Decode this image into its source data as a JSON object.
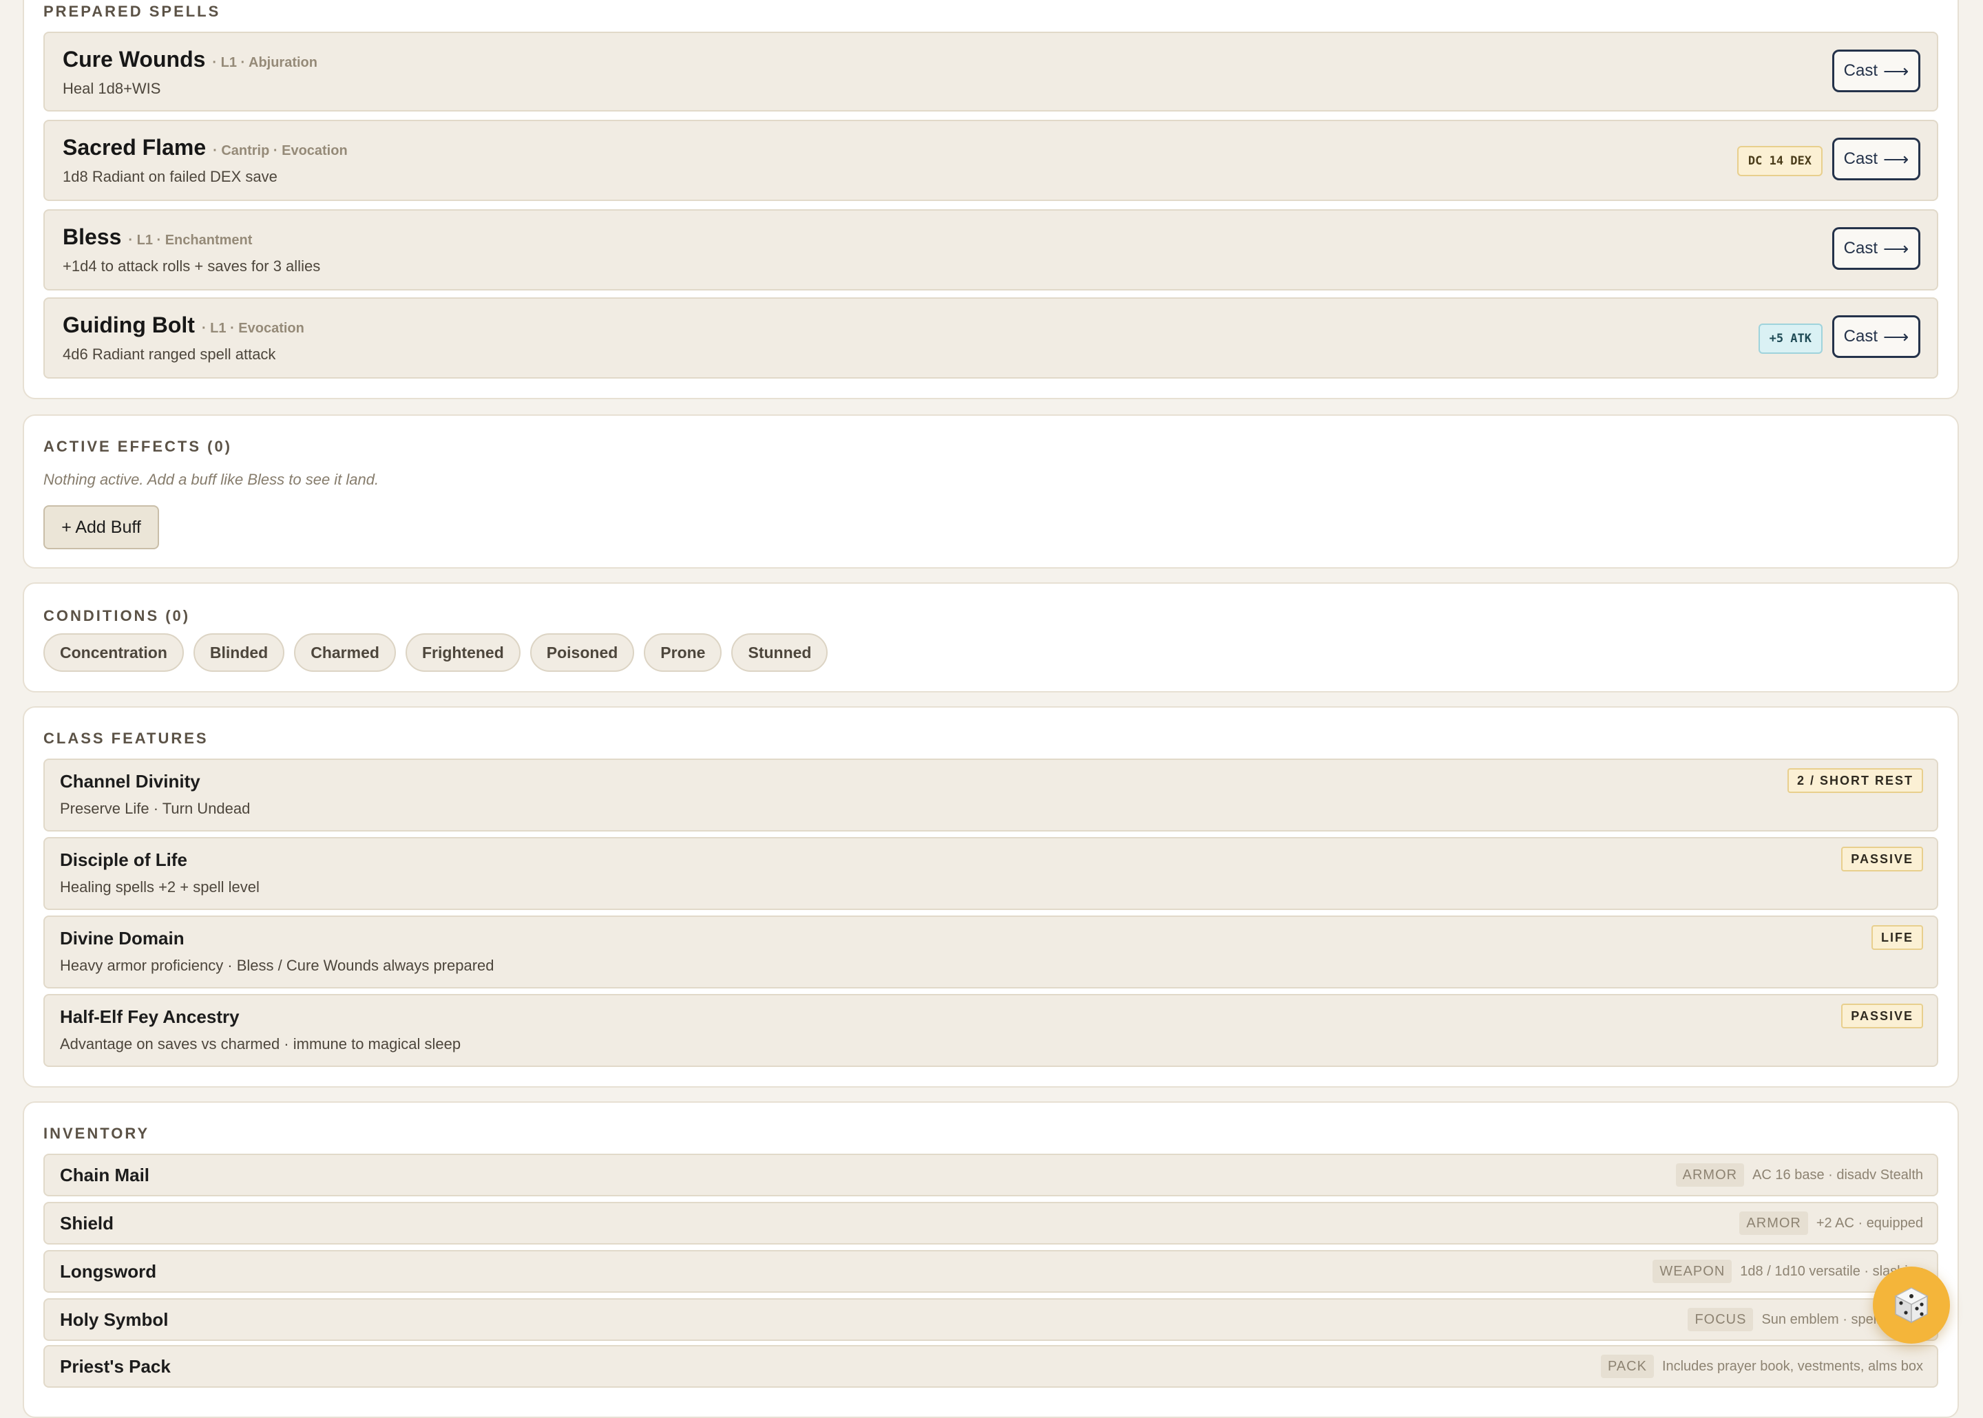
{
  "prepared_spells": {
    "title": "PREPARED SPELLS",
    "cast_label": "Cast",
    "cast_arrow": "⟶",
    "spells": [
      {
        "name": "Cure Wounds",
        "meta": "· L1 · Abjuration",
        "desc": "Heal 1d8+WIS",
        "badge": ""
      },
      {
        "name": "Sacred Flame",
        "meta": "· Cantrip · Evocation",
        "desc": "1d8 Radiant on failed DEX save",
        "badge": "DC 14 DEX"
      },
      {
        "name": "Bless",
        "meta": "· L1 · Enchantment",
        "desc": "+1d4 to attack rolls + saves for 3 allies",
        "badge": ""
      },
      {
        "name": "Guiding Bolt",
        "meta": "· L1 · Evocation",
        "desc": "4d6 Radiant ranged spell attack",
        "badge": "+5 ATK"
      }
    ]
  },
  "active_effects": {
    "title": "ACTIVE EFFECTS (0)",
    "hint": "Nothing active. Add a buff like Bless to see it land.",
    "add_button": "+ Add Buff"
  },
  "conditions": {
    "title": "CONDITIONS (0)",
    "chips": [
      "Concentration",
      "Blinded",
      "Charmed",
      "Frightened",
      "Poisoned",
      "Prone",
      "Stunned"
    ]
  },
  "class_features": {
    "title": "CLASS FEATURES",
    "items": [
      {
        "name": "Channel Divinity",
        "desc": "Preserve Life · Turn Undead",
        "badge": "2 / SHORT REST"
      },
      {
        "name": "Disciple of Life",
        "desc": "Healing spells +2 + spell level",
        "badge": "PASSIVE"
      },
      {
        "name": "Divine Domain",
        "desc": "Heavy armor proficiency · Bless / Cure Wounds always prepared",
        "badge": "LIFE"
      },
      {
        "name": "Half-Elf Fey Ancestry",
        "desc": "Advantage on saves vs charmed · immune to magical sleep",
        "badge": "PASSIVE"
      }
    ]
  },
  "inventory": {
    "title": "INVENTORY",
    "items": [
      {
        "name": "Chain Mail",
        "type": "ARMOR",
        "note": "AC 16 base · disadv Stealth"
      },
      {
        "name": "Shield",
        "type": "ARMOR",
        "note": "+2 AC · equipped"
      },
      {
        "name": "Longsword",
        "type": "WEAPON",
        "note": "1d8 / 1d10 versatile · slashing"
      },
      {
        "name": "Holy Symbol",
        "type": "FOCUS",
        "note": "Sun emblem · spellcasting"
      },
      {
        "name": "Priest's Pack",
        "type": "PACK",
        "note": "Includes prayer book, vestments, alms box"
      }
    ]
  },
  "dice_button": {
    "icon": "dice-icon"
  },
  "colors": {
    "accent": "#24324a",
    "card_bg": "#ffffff",
    "page_bg": "#f5f2ec",
    "badge_gold": "#fbf0d4",
    "badge_teal": "#daf1f4",
    "dice_fab": "#f4b53a"
  }
}
